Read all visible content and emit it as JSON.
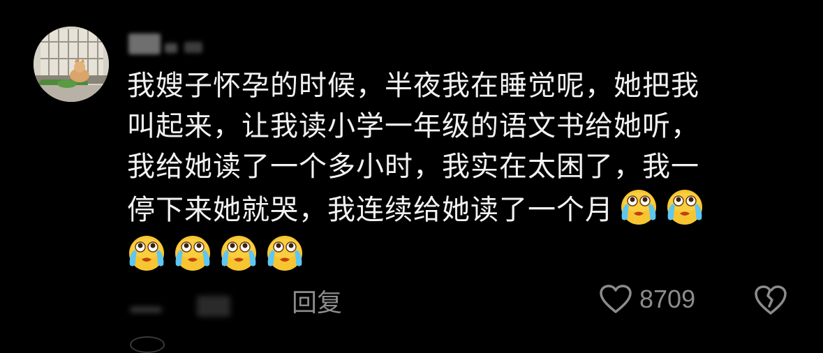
{
  "comment": {
    "avatar_icon": "cat-photo-avatar",
    "text_lines": [
      "我嫂子怀孕的时候，半夜我在睡觉呢，她把我",
      "叫起来，让我读小学一年级的语文书给她听，",
      "我给她读了一个多小时，我实在太困了，我一",
      "停下来她就哭，我连续给她读了一个月"
    ],
    "emoji_name": "crying-laughing-emoji",
    "reply_label": "回复",
    "like_count": "8709",
    "like_icon": "heart-outline-icon",
    "dislike_icon": "broken-heart-icon"
  },
  "colors": {
    "background": "#000000",
    "text": "#f2f2f2",
    "secondary_text": "#8c8c8c"
  }
}
